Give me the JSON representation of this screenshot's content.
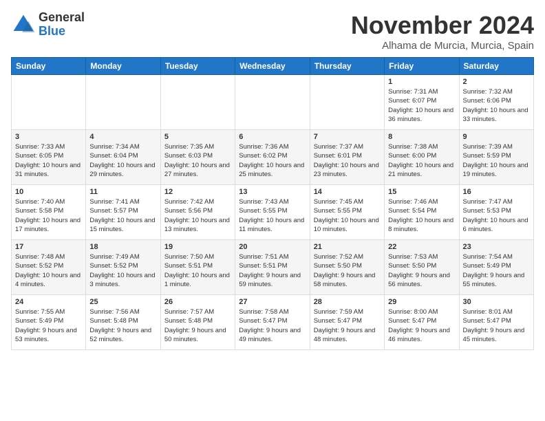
{
  "logo": {
    "general": "General",
    "blue": "Blue"
  },
  "title": "November 2024",
  "location": "Alhama de Murcia, Murcia, Spain",
  "weekdays": [
    "Sunday",
    "Monday",
    "Tuesday",
    "Wednesday",
    "Thursday",
    "Friday",
    "Saturday"
  ],
  "weeks": [
    [
      {
        "day": "",
        "info": ""
      },
      {
        "day": "",
        "info": ""
      },
      {
        "day": "",
        "info": ""
      },
      {
        "day": "",
        "info": ""
      },
      {
        "day": "",
        "info": ""
      },
      {
        "day": "1",
        "info": "Sunrise: 7:31 AM\nSunset: 6:07 PM\nDaylight: 10 hours and 36 minutes."
      },
      {
        "day": "2",
        "info": "Sunrise: 7:32 AM\nSunset: 6:06 PM\nDaylight: 10 hours and 33 minutes."
      }
    ],
    [
      {
        "day": "3",
        "info": "Sunrise: 7:33 AM\nSunset: 6:05 PM\nDaylight: 10 hours and 31 minutes."
      },
      {
        "day": "4",
        "info": "Sunrise: 7:34 AM\nSunset: 6:04 PM\nDaylight: 10 hours and 29 minutes."
      },
      {
        "day": "5",
        "info": "Sunrise: 7:35 AM\nSunset: 6:03 PM\nDaylight: 10 hours and 27 minutes."
      },
      {
        "day": "6",
        "info": "Sunrise: 7:36 AM\nSunset: 6:02 PM\nDaylight: 10 hours and 25 minutes."
      },
      {
        "day": "7",
        "info": "Sunrise: 7:37 AM\nSunset: 6:01 PM\nDaylight: 10 hours and 23 minutes."
      },
      {
        "day": "8",
        "info": "Sunrise: 7:38 AM\nSunset: 6:00 PM\nDaylight: 10 hours and 21 minutes."
      },
      {
        "day": "9",
        "info": "Sunrise: 7:39 AM\nSunset: 5:59 PM\nDaylight: 10 hours and 19 minutes."
      }
    ],
    [
      {
        "day": "10",
        "info": "Sunrise: 7:40 AM\nSunset: 5:58 PM\nDaylight: 10 hours and 17 minutes."
      },
      {
        "day": "11",
        "info": "Sunrise: 7:41 AM\nSunset: 5:57 PM\nDaylight: 10 hours and 15 minutes."
      },
      {
        "day": "12",
        "info": "Sunrise: 7:42 AM\nSunset: 5:56 PM\nDaylight: 10 hours and 13 minutes."
      },
      {
        "day": "13",
        "info": "Sunrise: 7:43 AM\nSunset: 5:55 PM\nDaylight: 10 hours and 11 minutes."
      },
      {
        "day": "14",
        "info": "Sunrise: 7:45 AM\nSunset: 5:55 PM\nDaylight: 10 hours and 10 minutes."
      },
      {
        "day": "15",
        "info": "Sunrise: 7:46 AM\nSunset: 5:54 PM\nDaylight: 10 hours and 8 minutes."
      },
      {
        "day": "16",
        "info": "Sunrise: 7:47 AM\nSunset: 5:53 PM\nDaylight: 10 hours and 6 minutes."
      }
    ],
    [
      {
        "day": "17",
        "info": "Sunrise: 7:48 AM\nSunset: 5:52 PM\nDaylight: 10 hours and 4 minutes."
      },
      {
        "day": "18",
        "info": "Sunrise: 7:49 AM\nSunset: 5:52 PM\nDaylight: 10 hours and 3 minutes."
      },
      {
        "day": "19",
        "info": "Sunrise: 7:50 AM\nSunset: 5:51 PM\nDaylight: 10 hours and 1 minute."
      },
      {
        "day": "20",
        "info": "Sunrise: 7:51 AM\nSunset: 5:51 PM\nDaylight: 9 hours and 59 minutes."
      },
      {
        "day": "21",
        "info": "Sunrise: 7:52 AM\nSunset: 5:50 PM\nDaylight: 9 hours and 58 minutes."
      },
      {
        "day": "22",
        "info": "Sunrise: 7:53 AM\nSunset: 5:50 PM\nDaylight: 9 hours and 56 minutes."
      },
      {
        "day": "23",
        "info": "Sunrise: 7:54 AM\nSunset: 5:49 PM\nDaylight: 9 hours and 55 minutes."
      }
    ],
    [
      {
        "day": "24",
        "info": "Sunrise: 7:55 AM\nSunset: 5:49 PM\nDaylight: 9 hours and 53 minutes."
      },
      {
        "day": "25",
        "info": "Sunrise: 7:56 AM\nSunset: 5:48 PM\nDaylight: 9 hours and 52 minutes."
      },
      {
        "day": "26",
        "info": "Sunrise: 7:57 AM\nSunset: 5:48 PM\nDaylight: 9 hours and 50 minutes."
      },
      {
        "day": "27",
        "info": "Sunrise: 7:58 AM\nSunset: 5:47 PM\nDaylight: 9 hours and 49 minutes."
      },
      {
        "day": "28",
        "info": "Sunrise: 7:59 AM\nSunset: 5:47 PM\nDaylight: 9 hours and 48 minutes."
      },
      {
        "day": "29",
        "info": "Sunrise: 8:00 AM\nSunset: 5:47 PM\nDaylight: 9 hours and 46 minutes."
      },
      {
        "day": "30",
        "info": "Sunrise: 8:01 AM\nSunset: 5:47 PM\nDaylight: 9 hours and 45 minutes."
      }
    ]
  ]
}
